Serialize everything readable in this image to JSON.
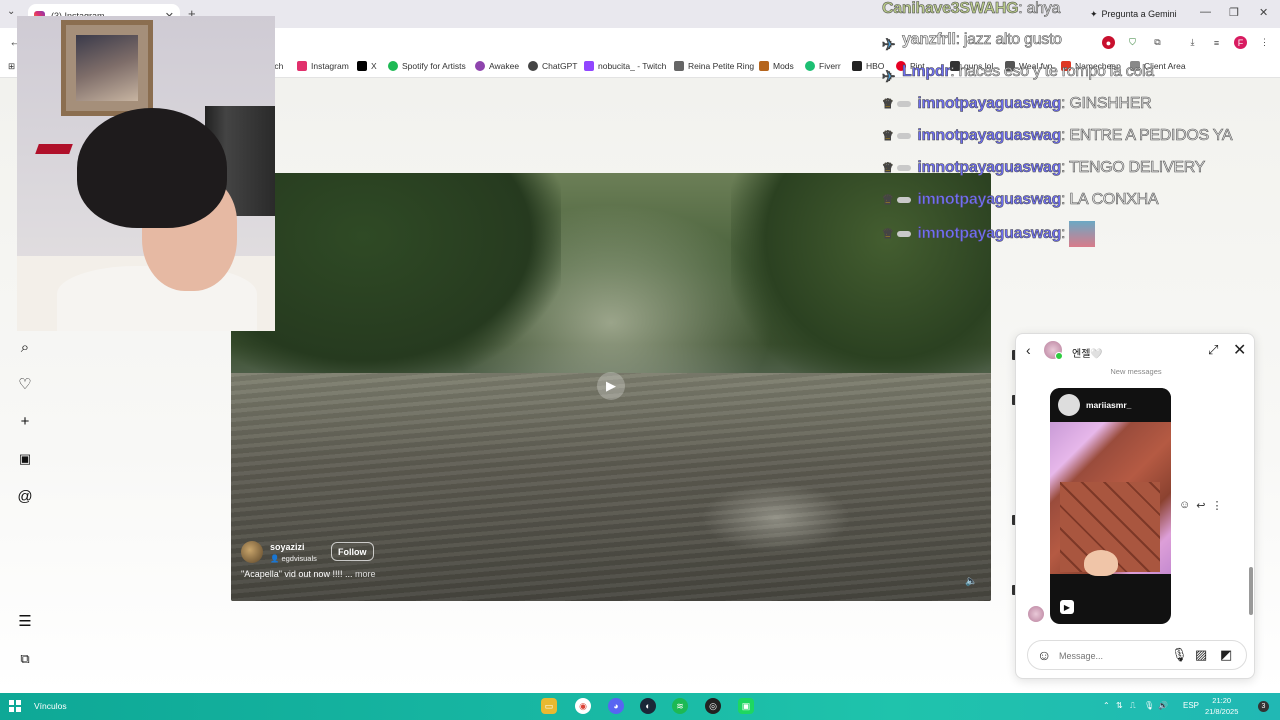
{
  "browser": {
    "tab_title": "(3) Instagram",
    "gemini_label": "Pregunta a Gemini",
    "bookmarks": [
      {
        "label": "tch",
        "color": "#9146ff"
      },
      {
        "label": "Instagram",
        "color": "#e1306c"
      },
      {
        "label": "X",
        "color": "#000000"
      },
      {
        "label": "Spotify for Artists",
        "color": "#1db954"
      },
      {
        "label": "Awakee",
        "color": "#8e44ad"
      },
      {
        "label": "ChatGPT",
        "color": "#444444"
      },
      {
        "label": "nobucita_ - Twitch",
        "color": "#9146ff"
      },
      {
        "label": "Reina Petite Ring",
        "color": "#666666"
      },
      {
        "label": "Mods",
        "color": "#b5651d"
      },
      {
        "label": "Fiverr",
        "color": "#1dbf73"
      },
      {
        "label": "HBO",
        "color": "#222222"
      },
      {
        "label": "Pint",
        "color": "#e60023"
      },
      {
        "label": "guns.lol",
        "color": "#333333"
      },
      {
        "label": "Weal fun",
        "color": "#555555"
      },
      {
        "label": "Namecheap",
        "color": "#de3723"
      },
      {
        "label": "Client Area",
        "color": "#888888"
      }
    ]
  },
  "stream_chat": [
    {
      "user": "Canihave3SWAHG",
      "message": ": ahya",
      "user_color": "#b8c98a"
    },
    {
      "user": "yanzfrll",
      "message": ": jazz alto gusto",
      "user_color": "#e6e6e6"
    },
    {
      "user": "Lmpdr",
      "message": ": haces eso y te rompo la cola",
      "user_color": "#6f6ff2"
    },
    {
      "user": "imnotpayaguaswag",
      "message": ": GINSHHER",
      "user_color": "#6f6ff2"
    },
    {
      "user": "imnotpayaguaswag",
      "message": ": ENTRE A PEDIDOS YA",
      "user_color": "#6f6ff2"
    },
    {
      "user": "imnotpayaguaswag",
      "message": ": TENGO DELIVERY",
      "user_color": "#6f6ff2"
    },
    {
      "user": "imnotpayaguaswag",
      "message": ": LA CONXHA",
      "user_color": "#6f6ff2"
    },
    {
      "user": "imnotpayaguaswag",
      "message": ":",
      "user_color": "#6f6ff2"
    }
  ],
  "sidebar": {
    "icons": [
      "search-icon",
      "heart-icon",
      "plus-icon",
      "analytics-icon",
      "threads-icon",
      "menu-icon",
      "apps-icon"
    ]
  },
  "reel": {
    "username": "soyazizi",
    "collab": "egdvisuals",
    "follow_label": "Follow",
    "caption": "\"Acapella\" vid out now !!!! ...",
    "more_label": "more"
  },
  "dm": {
    "contact_name": "엔젤🤍",
    "new_messages_label": "New messages",
    "shared_post_user": "mariiasmr_",
    "input_placeholder": "Message..."
  },
  "taskbar": {
    "label": "Vínculos",
    "lang": "ESP",
    "time": "21:20",
    "date": "21/8/2025",
    "notifications": "3"
  }
}
